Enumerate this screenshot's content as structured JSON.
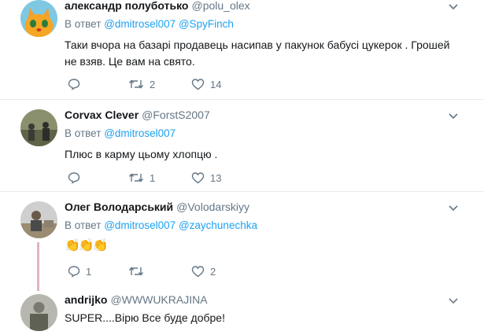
{
  "tweets": [
    {
      "name": "александр полуботько",
      "handle": "@polu_olex",
      "reply_prefix": "В ответ",
      "reply_mentions": [
        "@dmitrosel007",
        "@SpyFinch"
      ],
      "text_lines": [
        "Таки вчора на базарі продавець насипав у пакунок бабусі цукерок .  Грошей",
        "не взяв. Це вам на свято."
      ],
      "replies": "",
      "retweets": "2",
      "likes": "14"
    },
    {
      "name": "Corvax Clever",
      "handle": "@ForstS2007",
      "reply_prefix": "В ответ",
      "reply_mentions": [
        "@dmitrosel007"
      ],
      "text_lines": [
        "Плюс в карму цьому хлопцю ."
      ],
      "replies": "",
      "retweets": "1",
      "likes": "13"
    },
    {
      "name": "Олег Володарський",
      "handle": "@Volodarskiyy",
      "reply_prefix": "В ответ",
      "reply_mentions": [
        "@dmitrosel007",
        "@zaychunechka"
      ],
      "emoji": "👏👏👏",
      "replies": "1",
      "retweets": "",
      "likes": "2"
    },
    {
      "name": "andrijko",
      "handle": "@WWWUKRAJINA",
      "text_lines": [
        "SUPER....Вірю Все буде добре!"
      ]
    }
  ],
  "colors": {
    "link": "#1da1f2",
    "muted": "#657786",
    "thread": "#e0b3c4"
  }
}
